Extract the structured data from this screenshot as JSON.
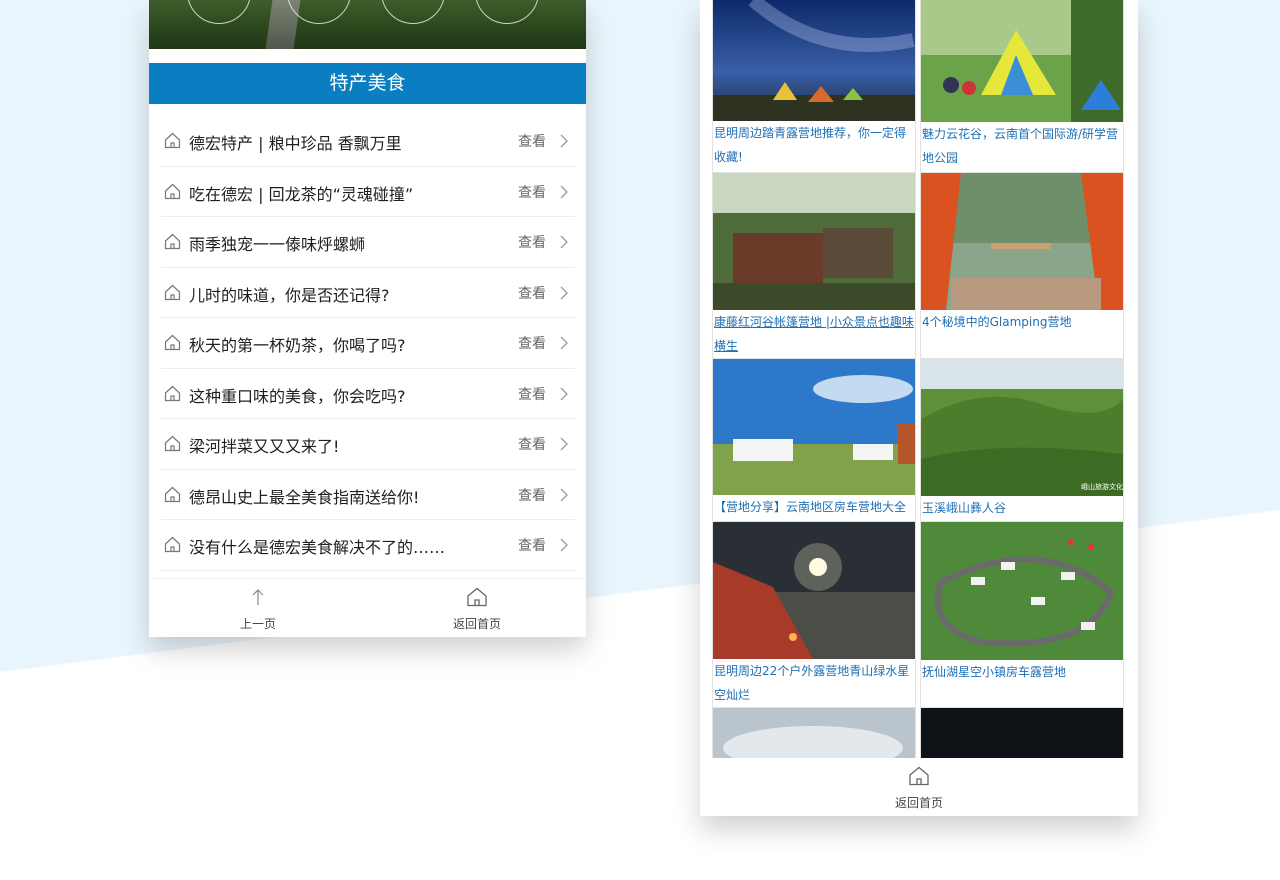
{
  "colors": {
    "accent": "#0a7ec1",
    "link": "#1e6fb5",
    "bg_band": "#e8f4fb"
  },
  "left_panel": {
    "section_title": "特产美食",
    "items": [
      {
        "text": "德宏特产 | 粮中珍品 香飘万里",
        "action": "查看"
      },
      {
        "text": "吃在德宏 | 回龙茶的“灵魂碰撞”",
        "action": "查看"
      },
      {
        "text": "雨季独宠一一傣味烀螺蛳",
        "action": "查看"
      },
      {
        "text": "儿时的味道，你是否还记得?",
        "action": "查看"
      },
      {
        "text": "秋天的第一杯奶茶，你喝了吗?",
        "action": "查看"
      },
      {
        "text": "这种重口味的美食，你会吃吗?",
        "action": "查看"
      },
      {
        "text": "梁河拌菜又又又来了!",
        "action": "查看"
      },
      {
        "text": "德昂山史上最全美食指南送给你!",
        "action": "查看"
      },
      {
        "text": "没有什么是德宏美食解决不了的……",
        "action": "查看"
      }
    ],
    "nav": {
      "prev_label": "上一页",
      "home_label": "返回首页"
    }
  },
  "right_panel": {
    "cards": [
      {
        "caption": "昆明周边踏青露营地推荐，你一定得收藏!",
        "image": "starry-camp"
      },
      {
        "caption": "魅力云花谷，云南首个国际游/研学营地公园",
        "image": "tent-camp"
      },
      {
        "caption": "康藤红河谷帐篷营地 |小众景点也趣味横生",
        "image": "forest-tent"
      },
      {
        "caption": "4个秘境中的Glamping营地",
        "image": "glamping"
      },
      {
        "caption": "【营地分享】云南地区房车营地大全",
        "image": "rv-camp"
      },
      {
        "caption": "玉溪峨山彝人谷",
        "image": "green-hills",
        "watermark": "峨山旅游文化"
      },
      {
        "caption": "昆明周边22个户外露营地青山绿水星空灿烂",
        "image": "night-lake"
      },
      {
        "caption": "抚仙湖星空小镇房车露营地",
        "image": "aerial-rv"
      }
    ],
    "nav": {
      "home_label": "返回首页"
    }
  }
}
